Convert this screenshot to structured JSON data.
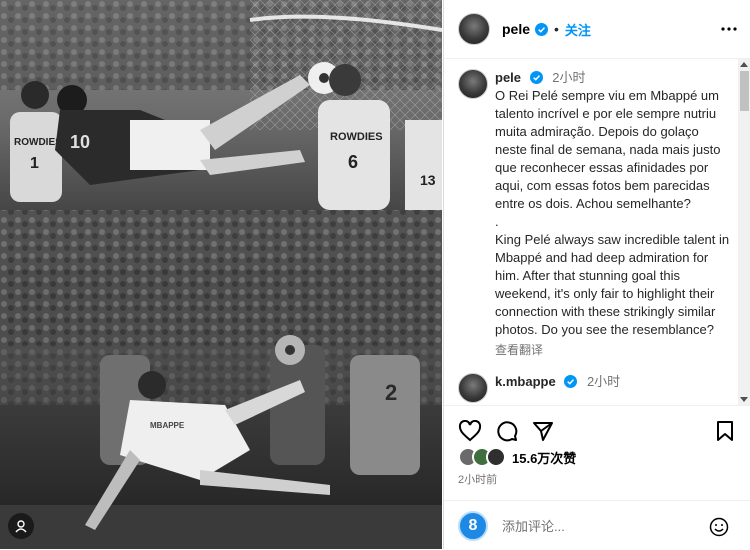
{
  "post": {
    "username": "pele",
    "follow_label": "关注",
    "caption_time": "2小时",
    "caption_pt": "O Rei Pelé sempre viu em Mbappé um talento incrível e por ele sempre nutriu muita admiração. Depois do golaço neste final de semana, nada mais justo que reconhecer essas afinidades por aqui, com essas fotos bem parecidas entre os dois. Achou semelhante?",
    "caption_sep": ".",
    "caption_en": "King Pelé always saw incredible talent in Mbappé and had deep admiration for him. After that stunning goal this weekend, it's only fair to highlight their connection with these strikingly similar photos. Do you see the resemblance?",
    "translate_label": "查看翻译"
  },
  "comment": {
    "username": "k.mbappe",
    "time": "2小时"
  },
  "photo": {
    "jersey_left": "ROWDIES",
    "jersey_left_number": "1",
    "jersey_right": "ROWDIES",
    "jersey_right_number": "6",
    "jersey_far_right_number": "13",
    "jersey_pele": "10",
    "shirt_mbappe": "MBAPPE",
    "shirt_number_defender": "2"
  },
  "likes": {
    "count_text": "15.6万次赞"
  },
  "post_time": "2小时前",
  "add_comment": {
    "placeholder": "添加评论..."
  },
  "icons": [
    "verified-icon",
    "more-icon",
    "heart-icon",
    "comment-icon",
    "share-icon",
    "bookmark-icon",
    "emoji-icon",
    "badge-icon",
    "story-icon"
  ],
  "colors": {
    "accent": "#0095f6",
    "verified": "#0095f6",
    "badge": "#1e88e5"
  }
}
